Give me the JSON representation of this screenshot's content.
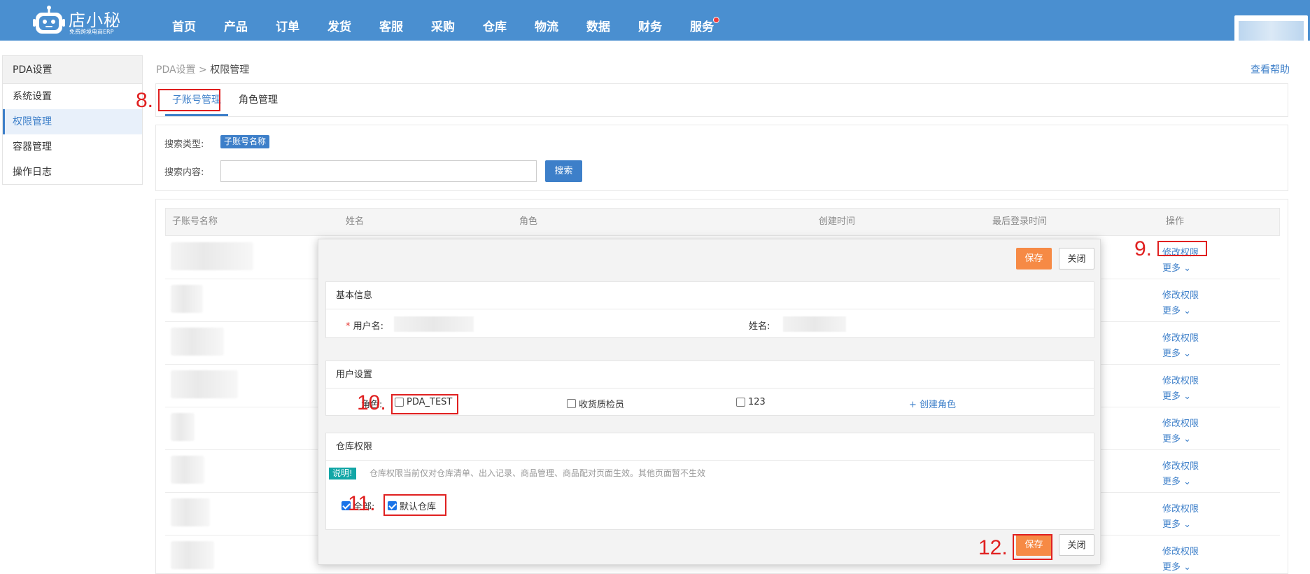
{
  "app": {
    "logo_name": "店小秘",
    "logo_sub": "免费跨境电商ERP",
    "nav": [
      "首页",
      "产品",
      "订单",
      "发货",
      "客服",
      "采购",
      "仓库",
      "物流",
      "数据",
      "财务",
      "服务"
    ]
  },
  "sidebar": {
    "title": "PDA设置",
    "items": [
      "系统设置",
      "权限管理",
      "容器管理",
      "操作日志"
    ]
  },
  "breadcrumb": {
    "parent": "PDA设置",
    "sep": ">",
    "current": "权限管理"
  },
  "help": "查看帮助",
  "tabs": [
    "子账号管理",
    "角色管理"
  ],
  "search": {
    "type_label": "搜索类型:",
    "type_value": "子账号名称",
    "content_label": "搜索内容:",
    "content_value": "",
    "button": "搜索"
  },
  "table": {
    "headers": [
      "子账号名称",
      "姓名",
      "角色",
      "创建时间",
      "最后登录时间",
      "操作"
    ],
    "row_action": "修改权限",
    "row_more": "更多",
    "row_count": 8
  },
  "modal": {
    "save": "保存",
    "close": "关闭",
    "basic": {
      "title": "基本信息",
      "username_label": "用户名:",
      "name_label": "姓名:"
    },
    "user_settings": {
      "title": "用户设置",
      "role_label": "角色:",
      "roles": [
        "PDA_TEST",
        "收货质检员",
        "123"
      ],
      "create_role": "+ 创建角色"
    },
    "warehouse": {
      "title": "仓库权限",
      "note_tag": "说明!",
      "note": "仓库权限当前仅对仓库清单、出入记录、商品管理、商品配对页面生效。其他页面暂不生效",
      "all_label": "全部:",
      "default_warehouse": "默认仓库"
    }
  },
  "annotations": [
    "8.",
    "9.",
    "10.",
    "11.",
    "12."
  ],
  "colors": {
    "nav_bg": "#4a8fd0",
    "accent": "#3d7fc9",
    "save": "#f68a45",
    "annotation": "#e02020"
  }
}
